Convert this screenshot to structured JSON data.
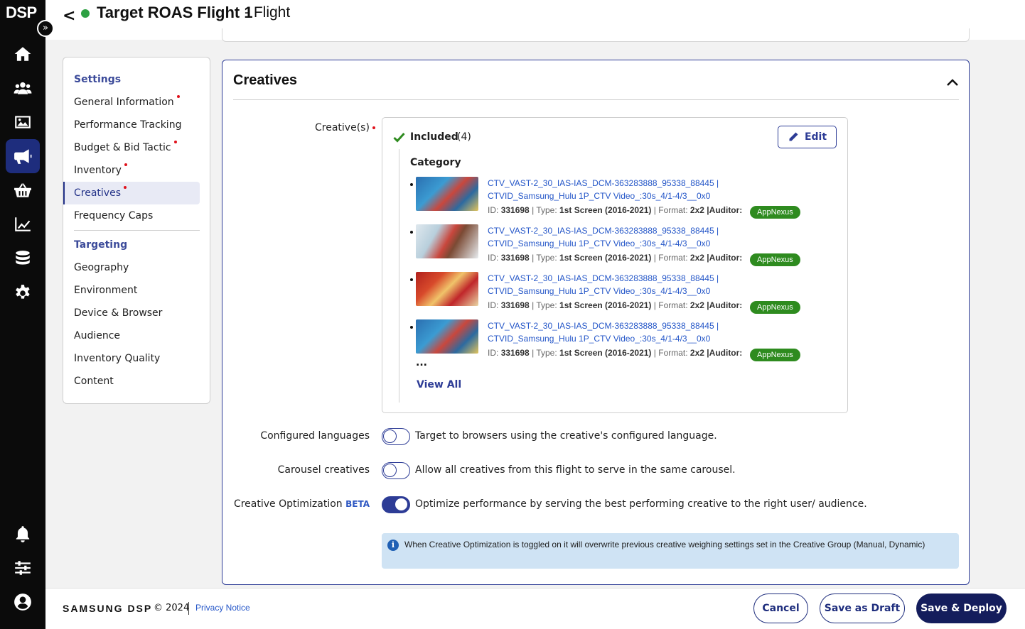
{
  "rail": {
    "logo": "DSP",
    "expand_glyph": "»",
    "items": [
      {
        "icon": "home-icon"
      },
      {
        "icon": "users-icon"
      },
      {
        "icon": "image-icon"
      },
      {
        "icon": "megaphone-icon",
        "active": true
      },
      {
        "icon": "basket-icon"
      },
      {
        "icon": "chart-icon"
      },
      {
        "icon": "database-icon"
      },
      {
        "icon": "gear-icon"
      },
      {
        "icon": "bell-icon"
      },
      {
        "icon": "sliders-icon"
      },
      {
        "icon": "account-icon"
      }
    ]
  },
  "header": {
    "back_glyph": "<",
    "title": "Target ROAS Flight 1",
    "separator_sub": "-  Flight",
    "status_color": "#2ea043"
  },
  "nav": {
    "settings_heading": "Settings",
    "settings_items": [
      {
        "label": "General Information",
        "required": true
      },
      {
        "label": "Performance Tracking",
        "required": false
      },
      {
        "label": "Budget & Bid Tactic",
        "required": true
      },
      {
        "label": "Inventory",
        "required": true
      },
      {
        "label": "Creatives",
        "required": true,
        "active": true
      },
      {
        "label": "Frequency Caps",
        "required": false
      }
    ],
    "targeting_heading": "Targeting",
    "targeting_items": [
      {
        "label": "Geography"
      },
      {
        "label": "Environment"
      },
      {
        "label": "Device & Browser"
      },
      {
        "label": "Audience"
      },
      {
        "label": "Inventory Quality"
      },
      {
        "label": "Content"
      }
    ]
  },
  "creatives": {
    "title": "Creatives",
    "field_label": "Creative(s)",
    "included_label": "Included",
    "included_count": "(4)",
    "edit_label": "Edit",
    "category_label": "Category",
    "items": [
      {
        "name_line1": "CTV_VAST-2_30_IAS-IAS_DCM-363283888_95338_88445 |",
        "name_line2": "CTVID_Samsung_Hulu 1P_CTV Video_:30s_4/1-4/3__0x0",
        "id_label": "ID:",
        "id": "331698",
        "type_label": "| Type:",
        "type": "1st Screen (2016-2021)",
        "format_label": "| Format:",
        "format": "2x2",
        "auditor_label": "|Auditor:",
        "auditor": "AppNexus",
        "thumb": "blue"
      },
      {
        "name_line1": "CTV_VAST-2_30_IAS-IAS_DCM-363283888_95338_88445 |",
        "name_line2": "CTVID_Samsung_Hulu 1P_CTV Video_:30s_4/1-4/3__0x0",
        "id_label": "ID:",
        "id": "331698",
        "type_label": "| Type:",
        "type": "1st Screen (2016-2021)",
        "format_label": "| Format:",
        "format": "2x2",
        "auditor_label": "|Auditor:",
        "auditor": "AppNexus",
        "thumb": "light"
      },
      {
        "name_line1": "CTV_VAST-2_30_IAS-IAS_DCM-363283888_95338_88445 |",
        "name_line2": "CTVID_Samsung_Hulu 1P_CTV Video_:30s_4/1-4/3__0x0",
        "id_label": "ID:",
        "id": "331698",
        "type_label": "| Type:",
        "type": "1st Screen (2016-2021)",
        "format_label": "| Format:",
        "format": "2x2",
        "auditor_label": "|Auditor:",
        "auditor": "AppNexus",
        "thumb": "red"
      },
      {
        "name_line1": "CTV_VAST-2_30_IAS-IAS_DCM-363283888_95338_88445 |",
        "name_line2": "CTVID_Samsung_Hulu 1P_CTV Video_:30s_4/1-4/3__0x0",
        "id_label": "ID:",
        "id": "331698",
        "type_label": "| Type:",
        "type": "1st Screen (2016-2021)",
        "format_label": "| Format:",
        "format": "2x2",
        "auditor_label": "|Auditor:",
        "auditor": "AppNexus",
        "thumb": "blue"
      }
    ],
    "ellipsis": "...",
    "view_all": "View All",
    "options": [
      {
        "label": "Configured languages",
        "description": "Target to browsers using the creative's configured language.",
        "on": false
      },
      {
        "label": "Carousel creatives",
        "description": "Allow all creatives from this flight to serve in the same carousel.",
        "on": false
      },
      {
        "label": "Creative Optimization",
        "badge": "BETA",
        "description": "Optimize performance by serving the best performing creative to the right user/ audience.",
        "on": true
      }
    ],
    "notice": "When Creative Optimization is toggled on it will overwrite previous creative weighing settings set in the Creative Group (Manual, Dynamic)",
    "notice_icon": "i"
  },
  "footer": {
    "brand": "SAMSUNG DSP",
    "copyright": "© 2024",
    "privacy": "Privacy Notice",
    "cancel": "Cancel",
    "save_draft": "Save as Draft",
    "save_deploy": "Save & Deploy"
  },
  "colors": {
    "primary": "#1e2d7d",
    "link": "#2456c8",
    "badge": "#2e8b1f",
    "required": "#e0111b",
    "notice_bg": "#cfe3f4"
  }
}
